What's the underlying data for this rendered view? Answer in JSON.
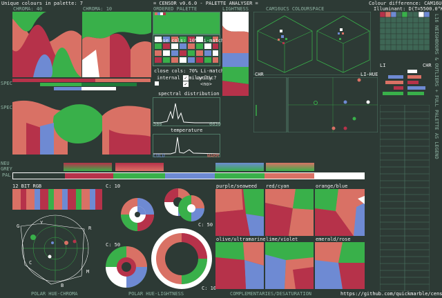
{
  "header": {
    "unique_colours": "Unique colours in palette: 7",
    "app_title": "= CENSOR v0.6.0 - PALETTE ANALYSER =",
    "colour_difference": "Colour difference: CAM16UCS",
    "illuminant": "Illuminant: D(T=5500.0°K)"
  },
  "top_labels": {
    "chroma40": "CHROMA: 40",
    "chroma10": "CHROMA: 10",
    "ordered": "ORDERED PALETTE",
    "lightness": "LIGHTNESS",
    "cam16": "CAM16UCS COLOURSPACE"
  },
  "left_labels": {
    "spectral": "SPEC",
    "grey": "GREY"
  },
  "side_labels": {
    "spec": "SPEC",
    "spec2": "SPEC",
    "nagrey": "NEU",
    "grey": "GREY",
    "pal": "PAL"
  },
  "middle": {
    "close_cols_1": "close cols: 10% Li-match",
    "close_cols_2": "close cols: 70% Li-match",
    "internal_similarity": "internal similarity",
    "cyclic": "cyclic?",
    "no": "<no>",
    "spectral_distribution": "spectral distribution",
    "spectral_min": "380",
    "spectral_max": "6630",
    "temperature": "temperature",
    "cold": "COLD",
    "warm": "WARM"
  },
  "charts": {
    "chr_label": "CHR",
    "li_hue_label": "LI-HUE",
    "li_label": "LI",
    "chr_label2": "CHR"
  },
  "bottom": {
    "rgb_12bit": "12 BIT RGB",
    "c10_a": "C: 10",
    "c50_a": "C: 50",
    "c50_b": "C: 50",
    "c10_b": "C: 10",
    "polar_hue_chroma": "POLAR HUE-CHROMA",
    "polar_hue_lightness": "POLAR HUE-LIGHTNESS",
    "complementaries": "COMPLEMENTARIES/DESATURATION",
    "github": "https://github.com/quickmarble/censor"
  },
  "polar_letters": {
    "g": "G",
    "y": "Y",
    "r": "R",
    "c": "C",
    "m": "M",
    "b": "B"
  },
  "cvd": {
    "purple_seaweed": "purple/seaweed",
    "red_cyan": "red/cyan",
    "orange_blue": "orange/blue",
    "olive_ultramarine": "olive/ultramarine",
    "lime_violet": "lime/violet",
    "emerald_rose": "emerald/rose"
  },
  "right_column": {
    "side_text": "L16 NEIGHBOURS & OUTLIERS + FULL PALETTE AS LEGEND"
  },
  "colors": {
    "background": "#2d3a35",
    "panel_border": "#4f7a66",
    "red": "#d97165",
    "green": "#39b04a",
    "blue": "#6e8ad3",
    "darkred": "#b6324a",
    "white": "#ffffff",
    "darkgreen": "#1f7a3a",
    "grey": "#3e4a45"
  }
}
